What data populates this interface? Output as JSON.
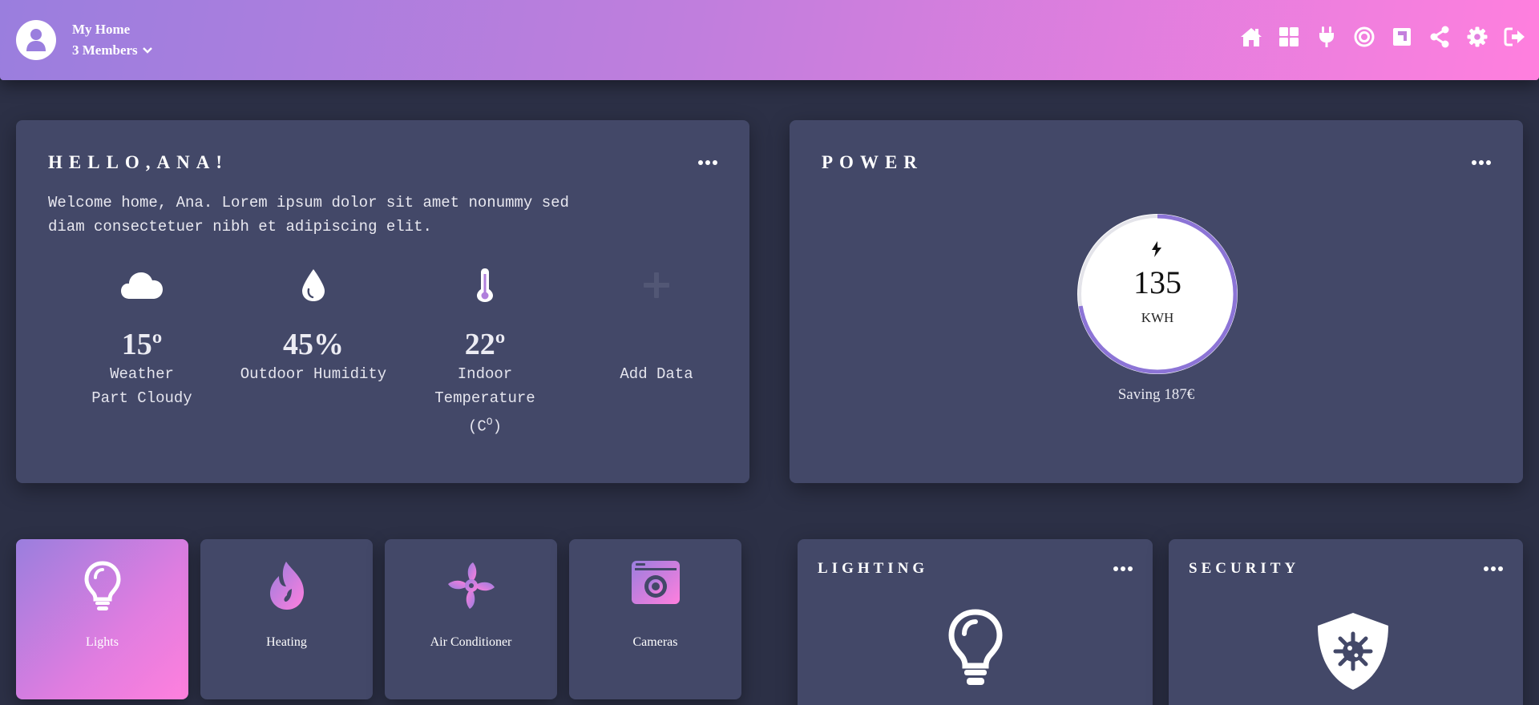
{
  "header": {
    "home_name": "My Home",
    "members": "3 Members",
    "nav_icons": [
      "home-icon",
      "dashboard-icon",
      "plug-icon",
      "target-icon",
      "floorplan-icon",
      "share-icon",
      "gear-icon",
      "logout-icon"
    ]
  },
  "welcome": {
    "title": "HELLO,ANA!",
    "text_line1": "Welcome home, Ana. Lorem ipsum dolor sit amet nonummy sed",
    "text_line2": "diam consectetuer nibh et adipiscing elit.",
    "stats": [
      {
        "icon": "cloud-icon",
        "value": "15º",
        "label1": "Weather",
        "label2": "Part Cloudy"
      },
      {
        "icon": "droplet-icon",
        "value": "45%",
        "label1": "Outdoor Humidity"
      },
      {
        "icon": "thermometer-icon",
        "value": "22º",
        "label1": "Indoor",
        "label2": "Temperature",
        "label3_prefix": "(C",
        "label3_sup": "O",
        "label3_suffix": ")"
      },
      {
        "icon": "plus-icon",
        "label1": "Add Data"
      }
    ]
  },
  "power": {
    "title": "POWER",
    "value": "135",
    "unit": "KWH",
    "saving": "Saving 187€",
    "gauge_fraction": 0.95
  },
  "devices": [
    {
      "label": "Lights",
      "icon": "lightbulb-icon",
      "active": true
    },
    {
      "label": "Heating",
      "icon": "flame-icon",
      "active": false
    },
    {
      "label": "Air Conditioner",
      "icon": "fan-icon",
      "active": false
    },
    {
      "label": "Cameras",
      "icon": "camera-icon",
      "active": false
    }
  ],
  "lighting": {
    "title": "LIGHTING"
  },
  "security": {
    "title": "SECURITY"
  },
  "colors": {
    "background": "#2c3046",
    "card": "#434868",
    "accent_start": "#9a7ede",
    "accent_end": "#ff7fde"
  }
}
